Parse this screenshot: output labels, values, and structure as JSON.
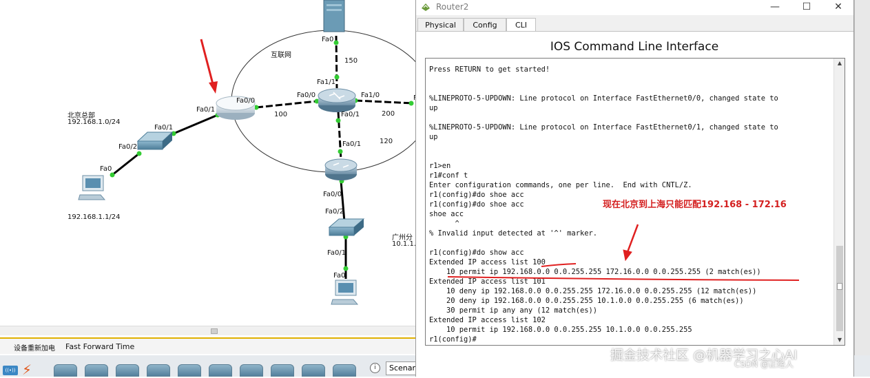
{
  "topology": {
    "cloud_label": "互联网",
    "beijing": {
      "name": "北京总部",
      "subnet": "192.168.1.0/24",
      "host_ip": "192.168.1.1/24"
    },
    "guangzhou": {
      "name": "广州分",
      "subnet": "10.1.1."
    },
    "ports": {
      "server_fa0": "Fa0",
      "r_center_fa11": "Fa1/1",
      "r_center_fa00": "Fa0/0",
      "r_center_fa10": "Fa1/0",
      "r_center_fa01": "Fa0/1",
      "r_edge_fa": "F",
      "r1_fa00": "Fa0/0",
      "r1_fa01": "Fa0/1",
      "sw_bj_fa01": "Fa0/1",
      "sw_bj_fa02": "Fa0/2",
      "pc_bj_fa0": "Fa0",
      "r_south_fa01": "Fa0/1",
      "r_south_fa00": "Fa0/0",
      "sw_gz_fa02": "Fa0/2",
      "sw_gz_fa01": "Fa0/1",
      "pc_gz_fa0": "Fa0"
    },
    "link_labels": {
      "north": "150",
      "west": "100",
      "east": "200",
      "south": "120"
    }
  },
  "status_bar": {
    "status": "设备重新加电",
    "time_mode": "Fast Forward Time"
  },
  "bottom_toolbar": {
    "scenario": "Scenar"
  },
  "window": {
    "title": "Router2",
    "controls": {
      "minimize": "—",
      "maximize": "☐",
      "close": "✕"
    },
    "tabs": [
      {
        "label": "Physical",
        "active": false
      },
      {
        "label": "Config",
        "active": false
      },
      {
        "label": "CLI",
        "active": true
      }
    ],
    "heading": "IOS Command Line Interface"
  },
  "cli": {
    "lines": [
      "Press RETURN to get started!",
      "",
      "",
      "%LINEPROTO-5-UPDOWN: Line protocol on Interface FastEthernet0/0, changed state to",
      "up",
      "",
      "%LINEPROTO-5-UPDOWN: Line protocol on Interface FastEthernet0/1, changed state to",
      "up",
      "",
      "",
      "r1>en",
      "r1#conf t",
      "Enter configuration commands, one per line.  End with CNTL/Z.",
      "r1(config)#do shoe acc",
      "r1(config)#do shoe acc",
      "shoe acc",
      "      ^",
      "% Invalid input detected at '^' marker.",
      "",
      "r1(config)#do show acc",
      "Extended IP access list 100",
      "    10 permit ip 192.168.0.0 0.0.255.255 172.16.0.0 0.0.255.255 (2 match(es))",
      "Extended IP access list 101",
      "    10 deny ip 192.168.0.0 0.0.255.255 172.16.0.0 0.0.255.255 (12 match(es))",
      "    20 deny ip 192.168.0.0 0.0.255.255 10.1.0.0 0.0.255.255 (6 match(es))",
      "    30 permit ip any any (12 match(es))",
      "Extended IP access list 102",
      "    10 permit ip 192.168.0.0 0.0.255.255 10.1.0.0 0.0.255.255",
      "r1(config)#"
    ]
  },
  "annotation": {
    "text": "现在北京到上海只能匹配192.168 - 172.16",
    "color": "#d42020"
  },
  "watermark": {
    "main": "掘金技术社区 @机器学习之心AI",
    "sub": "CSDN @正经人"
  },
  "colors": {
    "link_port_dot": "#33cc33",
    "annotation_red": "#e02020"
  }
}
